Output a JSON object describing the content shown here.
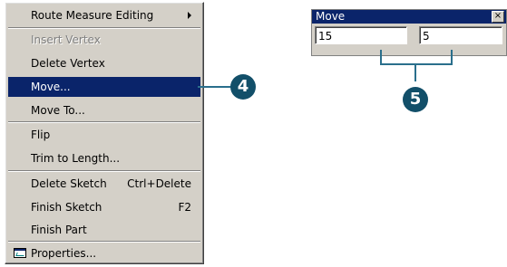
{
  "context_menu": {
    "items": [
      {
        "label": "Route Measure Editing",
        "has_submenu": true
      },
      {
        "label": "Insert Vertex",
        "disabled": true
      },
      {
        "label": "Delete Vertex"
      },
      {
        "label": "Move...",
        "selected": true
      },
      {
        "label": "Move To..."
      },
      {
        "label": "Flip"
      },
      {
        "label": "Trim to Length..."
      },
      {
        "label": "Delete Sketch",
        "shortcut": "Ctrl+Delete"
      },
      {
        "label": "Finish Sketch",
        "shortcut": "F2"
      },
      {
        "label": "Finish Part"
      },
      {
        "label": "Properties...",
        "icon": "properties-icon"
      }
    ]
  },
  "callouts": {
    "step4": "4",
    "step5": "5"
  },
  "move_dialog": {
    "title": "Move",
    "close_glyph": "×",
    "x_value": "15",
    "y_value": "5"
  },
  "colors": {
    "menu_bg": "#d4d0c8",
    "selection": "#0a246a",
    "callout": "#124f69"
  }
}
